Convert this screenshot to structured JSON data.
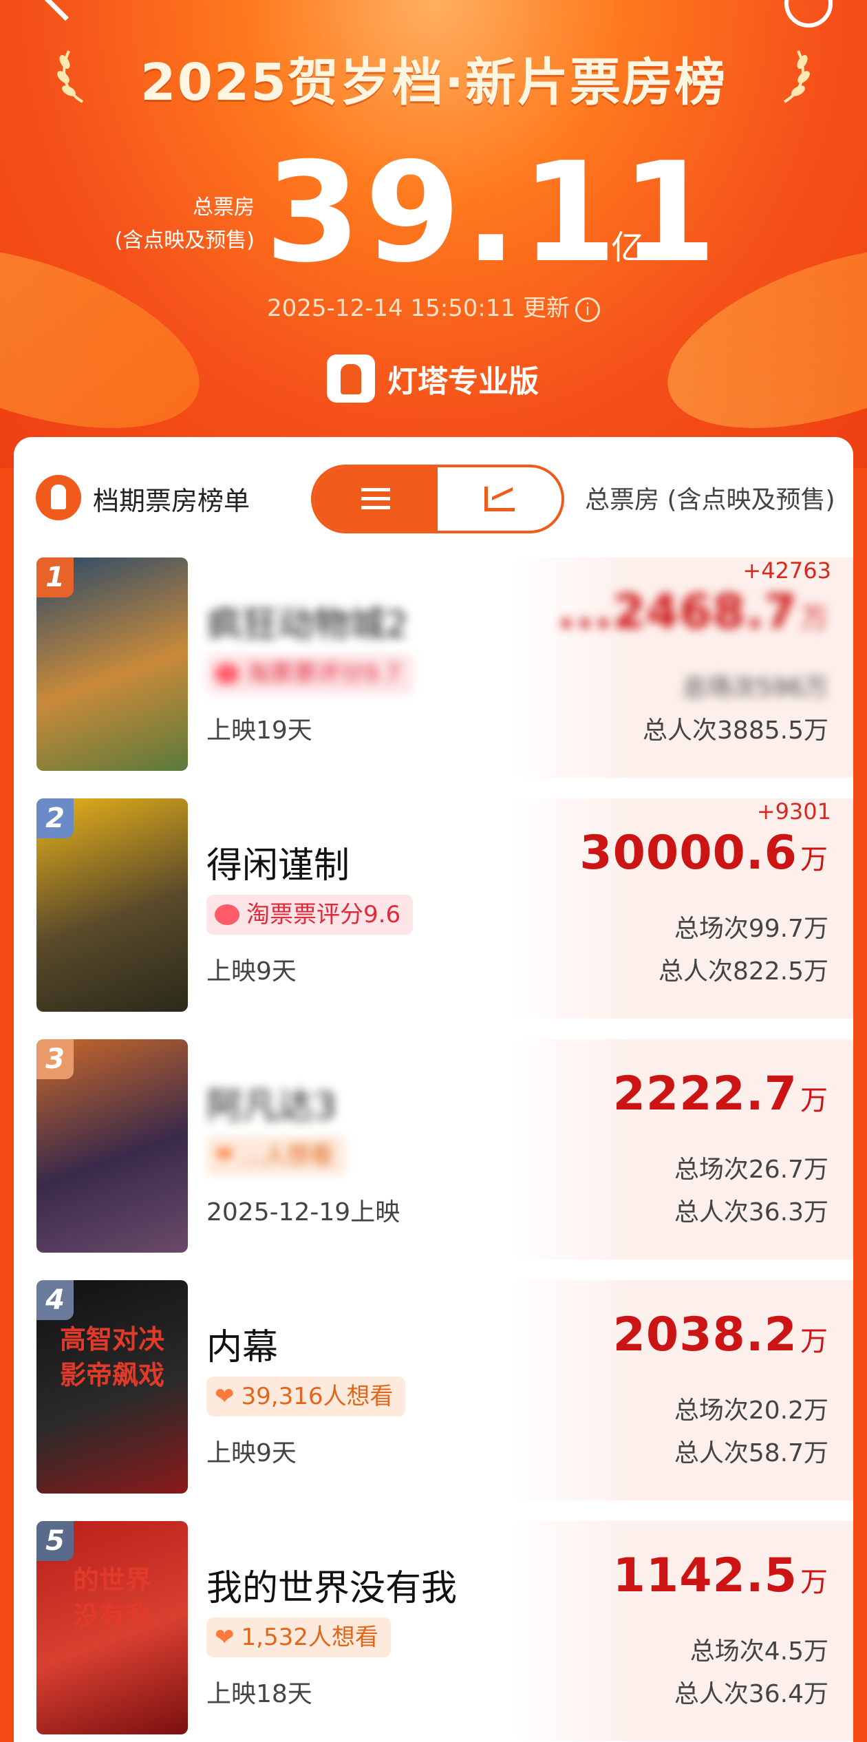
{
  "header": {
    "title": "2025贺岁档·新片票房榜",
    "total_label_line1": "总票房",
    "total_label_line2": "(含点映及预售)",
    "total_value": "39.11",
    "total_unit": "亿",
    "updated": "2025-12-14 15:50:11 更新",
    "brand": "灯塔专业版"
  },
  "panel": {
    "title": "档期票房榜单",
    "right_label": "总票房 (含点映及预售)",
    "toggle": [
      "list-view",
      "trend-view"
    ]
  },
  "movies": [
    {
      "rank": "1",
      "name": "疯狂动物城2",
      "tag": "淘票票评分9.7",
      "tag_type": "rating",
      "sub": "上映19天",
      "increment": "+42763",
      "gross": "...2468.7",
      "unit": "万",
      "shows": "总场次596万",
      "people": "总人次3885.5万",
      "blurred": true,
      "poster_colors": [
        "#2a4a6a",
        "#c98a3a",
        "#5a7a3a"
      ]
    },
    {
      "rank": "2",
      "name": "得闲谨制",
      "tag": "淘票票评分9.6",
      "tag_type": "rating",
      "sub": "上映9天",
      "increment": "+9301",
      "gross": "30000.6",
      "unit": "万",
      "shows": "总场次99.7万",
      "people": "总人次822.5万",
      "blurred": false,
      "poster_colors": [
        "#e8b21a",
        "#5a4a2a",
        "#2a2a1a"
      ]
    },
    {
      "rank": "3",
      "name": "阿凡达3",
      "tag": "...人想看",
      "tag_type": "want",
      "sub": "2025-12-19上映",
      "increment": "",
      "gross": "2222.7",
      "unit": "万",
      "shows": "总场次26.7万",
      "people": "总人次36.3万",
      "blurred": true,
      "poster_colors": [
        "#c8682a",
        "#3a2a4a",
        "#6a4a6a"
      ]
    },
    {
      "rank": "4",
      "name": "内幕",
      "tag": "39,316人想看",
      "tag_type": "want",
      "sub": "上映9天",
      "increment": "",
      "gross": "2038.2",
      "unit": "万",
      "shows": "总场次20.2万",
      "people": "总人次58.7万",
      "blurred": false,
      "poster_colors": [
        "#111111",
        "#2a2a2a",
        "#8a1a1a"
      ],
      "poster_text": "高智对决 影帝飙戏"
    },
    {
      "rank": "5",
      "name": "我的世界没有我",
      "tag": "1,532人想看",
      "tag_type": "want",
      "sub": "上映18天",
      "increment": "",
      "gross": "1142.5",
      "unit": "万",
      "shows": "总场次4.5万",
      "people": "总人次36.4万",
      "blurred": false,
      "poster_colors": [
        "#b8201a",
        "#d84030",
        "#7a1010"
      ],
      "poster_text": "的世界 没有我"
    }
  ],
  "rank_colors": [
    "#e8632a",
    "#6a8ac8",
    "#e89a6a",
    "#6a7a9a",
    "#5a6a8a"
  ]
}
